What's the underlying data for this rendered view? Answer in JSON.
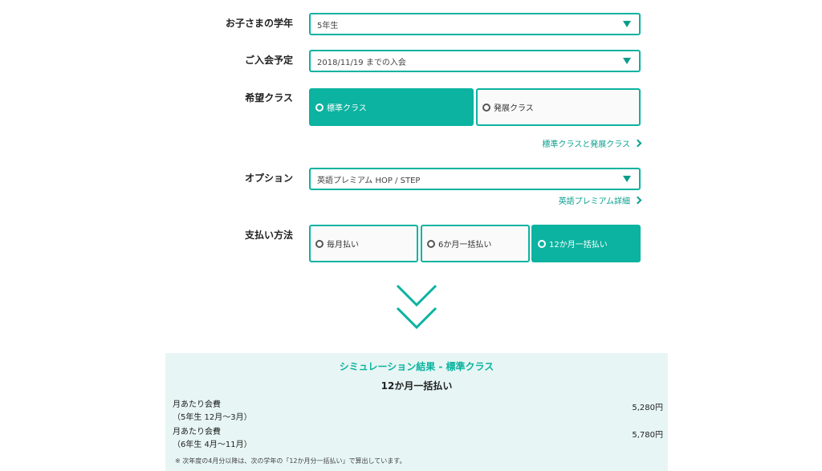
{
  "form": {
    "grade": {
      "label": "お子さまの学年",
      "value": "5年生"
    },
    "join_date": {
      "label": "ご入会予定",
      "value": "2018/11/19 までの入会"
    },
    "class": {
      "label": "希望クラス",
      "options": [
        "標準クラス",
        "発展クラス"
      ],
      "selected": "標準クラス",
      "link": "標準クラスと発展クラス"
    },
    "option": {
      "label": "オプション",
      "value": "英語プレミアム HOP / STEP",
      "link": "英語プレミアム詳細"
    },
    "payment": {
      "label": "支払い方法",
      "options": [
        "毎月払い",
        "6か月一括払い",
        "12か月一括払い"
      ],
      "selected": "12か月一括払い"
    }
  },
  "result": {
    "title": "シミュレーション結果 - 標準クラス",
    "subtitle": "12か月一括払い",
    "rows": [
      {
        "label": "月あたり会費",
        "period": "（5年生 12月～3月）",
        "value": "5,280円"
      },
      {
        "label": "月あたり会費",
        "period": "（6年生 4月～11月）",
        "value": "5,780円"
      }
    ],
    "note": "※ 次年度の4月分以降は、次の学年の「12か月分一括払い」で算出しています。"
  },
  "colors": {
    "accent": "#0bb3a0",
    "result_bg": "#e7f6f4"
  }
}
